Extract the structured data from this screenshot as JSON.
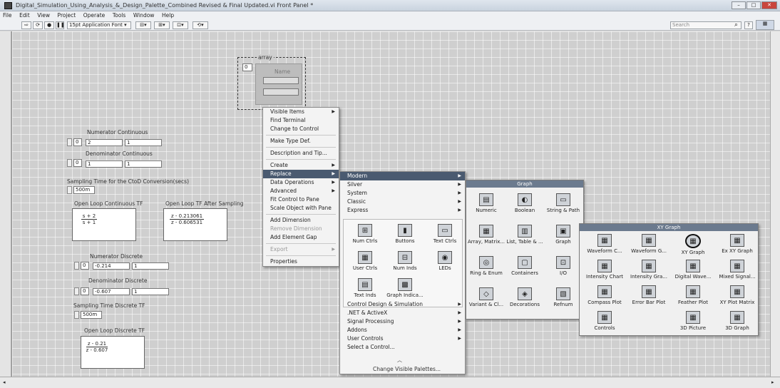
{
  "window": {
    "title": "Digital_Simulation_Using_Analysis_&_Design_Palette_Combined Revised & Final Updated.vi Front Panel *"
  },
  "menubar": [
    "File",
    "Edit",
    "View",
    "Project",
    "Operate",
    "Tools",
    "Window",
    "Help"
  ],
  "toolbar": {
    "font": "15pt Application Font",
    "search_placeholder": "Search"
  },
  "front_panel": {
    "cluster": {
      "label": "array",
      "index": "0",
      "inner_label": "Name"
    },
    "num_cont": {
      "label": "Numerator Continuous",
      "index": "0",
      "v1": "2",
      "v2": "1"
    },
    "den_cont": {
      "label": "Denominator Continuous",
      "index": "0",
      "v1": "1",
      "v2": "1"
    },
    "sampling_ctd": {
      "label": "Sampling Time for the CtoD Conversion(secs)",
      "value": "500m"
    },
    "open_loop_cont": {
      "label": "Open Loop Continuous TF",
      "num": "s + 2",
      "den": "s + 1"
    },
    "open_loop_after": {
      "label": "Open Loop TF After Sampling",
      "num": "z - 0.213061",
      "den": "z - 0.606531"
    },
    "num_disc": {
      "label": "Numerator Discrete",
      "index": "0",
      "v1": "-0.214",
      "v2": "1"
    },
    "den_disc": {
      "label": "Denominator Discrete",
      "index": "0",
      "v1": "-0.607",
      "v2": "1"
    },
    "sampling_disc": {
      "label": "Sampling Time Discrete TF",
      "value": "500m"
    },
    "open_loop_disc": {
      "label": "Open Loop Discrete TF",
      "num": "z - 0.21",
      "den": "z - 0.607"
    }
  },
  "context_menu": {
    "items": [
      {
        "label": "Visible Items",
        "sub": true
      },
      {
        "label": "Find Terminal"
      },
      {
        "label": "Change to Control"
      },
      {
        "sep": true
      },
      {
        "label": "Make Type Def."
      },
      {
        "sep": true
      },
      {
        "label": "Description and Tip..."
      },
      {
        "sep": true
      },
      {
        "label": "Create",
        "sub": true
      },
      {
        "label": "Replace",
        "sub": true,
        "selected": true
      },
      {
        "label": "Data Operations",
        "sub": true
      },
      {
        "label": "Advanced",
        "sub": true
      },
      {
        "label": "Fit Control to Pane"
      },
      {
        "label": "Scale Object with Pane"
      },
      {
        "sep": true
      },
      {
        "label": "Add Dimension"
      },
      {
        "label": "Remove Dimension",
        "disabled": true
      },
      {
        "label": "Add Element Gap"
      },
      {
        "sep": true
      },
      {
        "label": "Export",
        "sub": true,
        "disabled": true
      },
      {
        "sep": true
      },
      {
        "label": "Properties"
      }
    ]
  },
  "replace_menu": {
    "top_items": [
      {
        "label": "Modern",
        "selected": true
      },
      {
        "label": "Silver"
      },
      {
        "label": "System"
      },
      {
        "label": "Classic"
      },
      {
        "label": "Express"
      }
    ],
    "express_palette": [
      {
        "label": "Num Ctrls",
        "icon": "numeric-control-icon"
      },
      {
        "label": "Buttons",
        "icon": "button-icon"
      },
      {
        "label": "Text Ctrls",
        "icon": "text-control-icon"
      },
      {
        "label": "User Ctrls",
        "icon": "user-control-icon"
      },
      {
        "label": "Num Inds",
        "icon": "numeric-indicator-icon"
      },
      {
        "label": "LEDs",
        "icon": "led-icon"
      },
      {
        "label": "Text Inds",
        "icon": "text-indicator-icon"
      },
      {
        "label": "Graph Indica...",
        "icon": "graph-indicator-icon"
      }
    ],
    "bottom_items": [
      {
        "label": "Control Design & Simulation"
      },
      {
        "label": ".NET & ActiveX"
      },
      {
        "label": "Signal Processing"
      },
      {
        "label": "Addons"
      },
      {
        "label": "User Controls"
      },
      {
        "label": "Select a Control..."
      }
    ],
    "change_palettes": "Change Visible Palettes..."
  },
  "modern_palette": {
    "items": [
      {
        "label": "Numeric"
      },
      {
        "label": "Boolean"
      },
      {
        "label": "String & Path"
      },
      {
        "label": "Array, Matrix..."
      },
      {
        "label": "List, Table & ..."
      },
      {
        "label": "Graph"
      },
      {
        "label": "Ring & Enum"
      },
      {
        "label": "Containers"
      },
      {
        "label": "I/O"
      },
      {
        "label": "Variant & Cl..."
      },
      {
        "label": "Decorations"
      },
      {
        "label": "Refnum"
      }
    ]
  },
  "graph_palette": {
    "title": "Graph"
  },
  "xy_palette": {
    "title": "XY Graph",
    "items": [
      {
        "label": "Waveform C..."
      },
      {
        "label": "Waveform G..."
      },
      {
        "label": "XY Graph",
        "highlighted": true
      },
      {
        "label": "Ex XY Graph"
      },
      {
        "label": "Intensity Chart"
      },
      {
        "label": "Intensity Gra..."
      },
      {
        "label": "Digital Wave..."
      },
      {
        "label": "Mixed Signal..."
      },
      {
        "label": "Compass Plot"
      },
      {
        "label": "Error Bar Plot"
      },
      {
        "label": "Feather Plot"
      },
      {
        "label": "XY Plot Matrix"
      },
      {
        "label": "Controls"
      },
      {
        "label": ""
      },
      {
        "label": "3D Picture"
      },
      {
        "label": "3D Graph"
      }
    ]
  }
}
